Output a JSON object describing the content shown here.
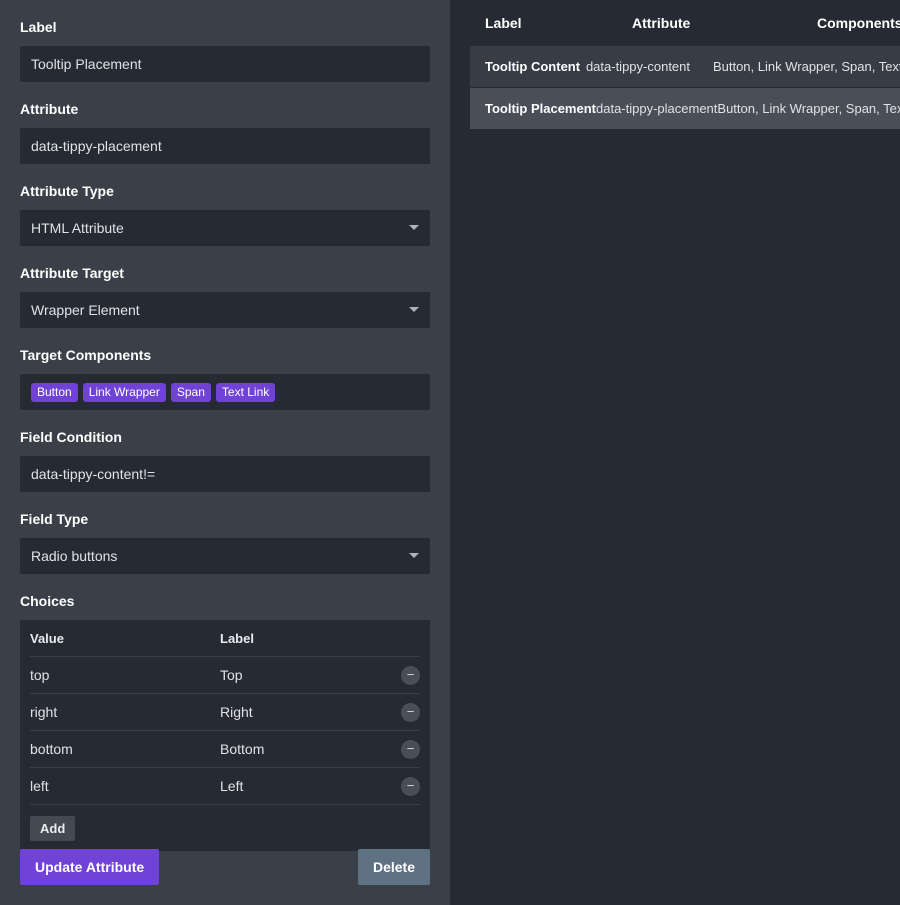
{
  "form": {
    "label": {
      "title": "Label",
      "value": "Tooltip Placement"
    },
    "attribute": {
      "title": "Attribute",
      "value": "data-tippy-placement"
    },
    "attribute_type": {
      "title": "Attribute Type",
      "value": "HTML Attribute"
    },
    "attribute_target": {
      "title": "Attribute Target",
      "value": "Wrapper Element"
    },
    "target_components": {
      "title": "Target Components",
      "tags": [
        "Button",
        "Link Wrapper",
        "Span",
        "Text Link"
      ]
    },
    "field_condition": {
      "title": "Field Condition",
      "value": "data-tippy-content!="
    },
    "field_type": {
      "title": "Field Type",
      "value": "Radio buttons"
    },
    "choices": {
      "title": "Choices",
      "col_value": "Value",
      "col_label": "Label",
      "rows": [
        {
          "value": "top",
          "label": "Top"
        },
        {
          "value": "right",
          "label": "Right"
        },
        {
          "value": "bottom",
          "label": "Bottom"
        },
        {
          "value": "left",
          "label": "Left"
        }
      ],
      "remove_symbol": "−",
      "add_label": "Add"
    },
    "update_label": "Update Attribute",
    "delete_label": "Delete"
  },
  "table": {
    "headers": [
      "Label",
      "Attribute",
      "Components"
    ],
    "rows": [
      {
        "label": "Tooltip Content",
        "attribute": "data-tippy-content",
        "components": "Button, Link Wrapper, Span, Text Link"
      },
      {
        "label": "Tooltip Placement",
        "attribute": "data-tippy-placement",
        "components": "Button, Link Wrapper, Span, Text Link"
      }
    ]
  },
  "colors": {
    "accent": "#7043d6",
    "panel": "#3b3f47",
    "background": "#262b33",
    "delete": "#5f7284"
  }
}
